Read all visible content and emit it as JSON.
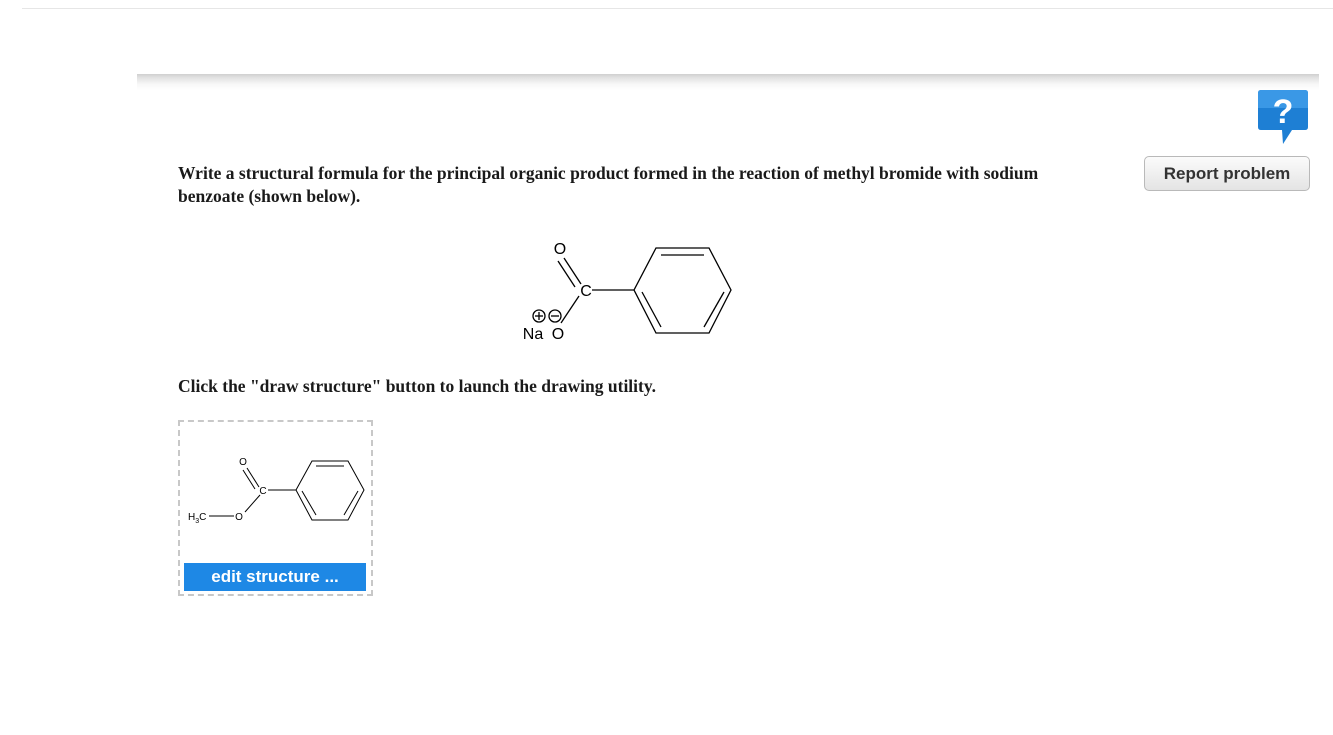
{
  "question": {
    "text": "Write a structural formula for the principal organic product formed in the reaction of methyl bromide with sodium benzoate (shown below)."
  },
  "instruction": {
    "text": "Click the \"draw structure\" button to launch the drawing utility."
  },
  "help": {
    "label": "?",
    "icon": "help-question-icon"
  },
  "report_button": {
    "label": "Report problem"
  },
  "reactant_structure": {
    "carbonyl_o": "O",
    "carbon": "C",
    "sodium": "Na",
    "oxide_o": "O",
    "plus_charge": "+",
    "minus_charge": "−"
  },
  "answer_structure": {
    "carbonyl_o": "O",
    "carbon": "C",
    "ester_o": "O",
    "methyl": "H",
    "methyl_sub": "3",
    "methyl_c": "C"
  },
  "edit_button": {
    "label": "edit structure ..."
  },
  "colors": {
    "edit_button_bg": "#1e88e5",
    "help_icon_bg": "#1e7fd4"
  }
}
